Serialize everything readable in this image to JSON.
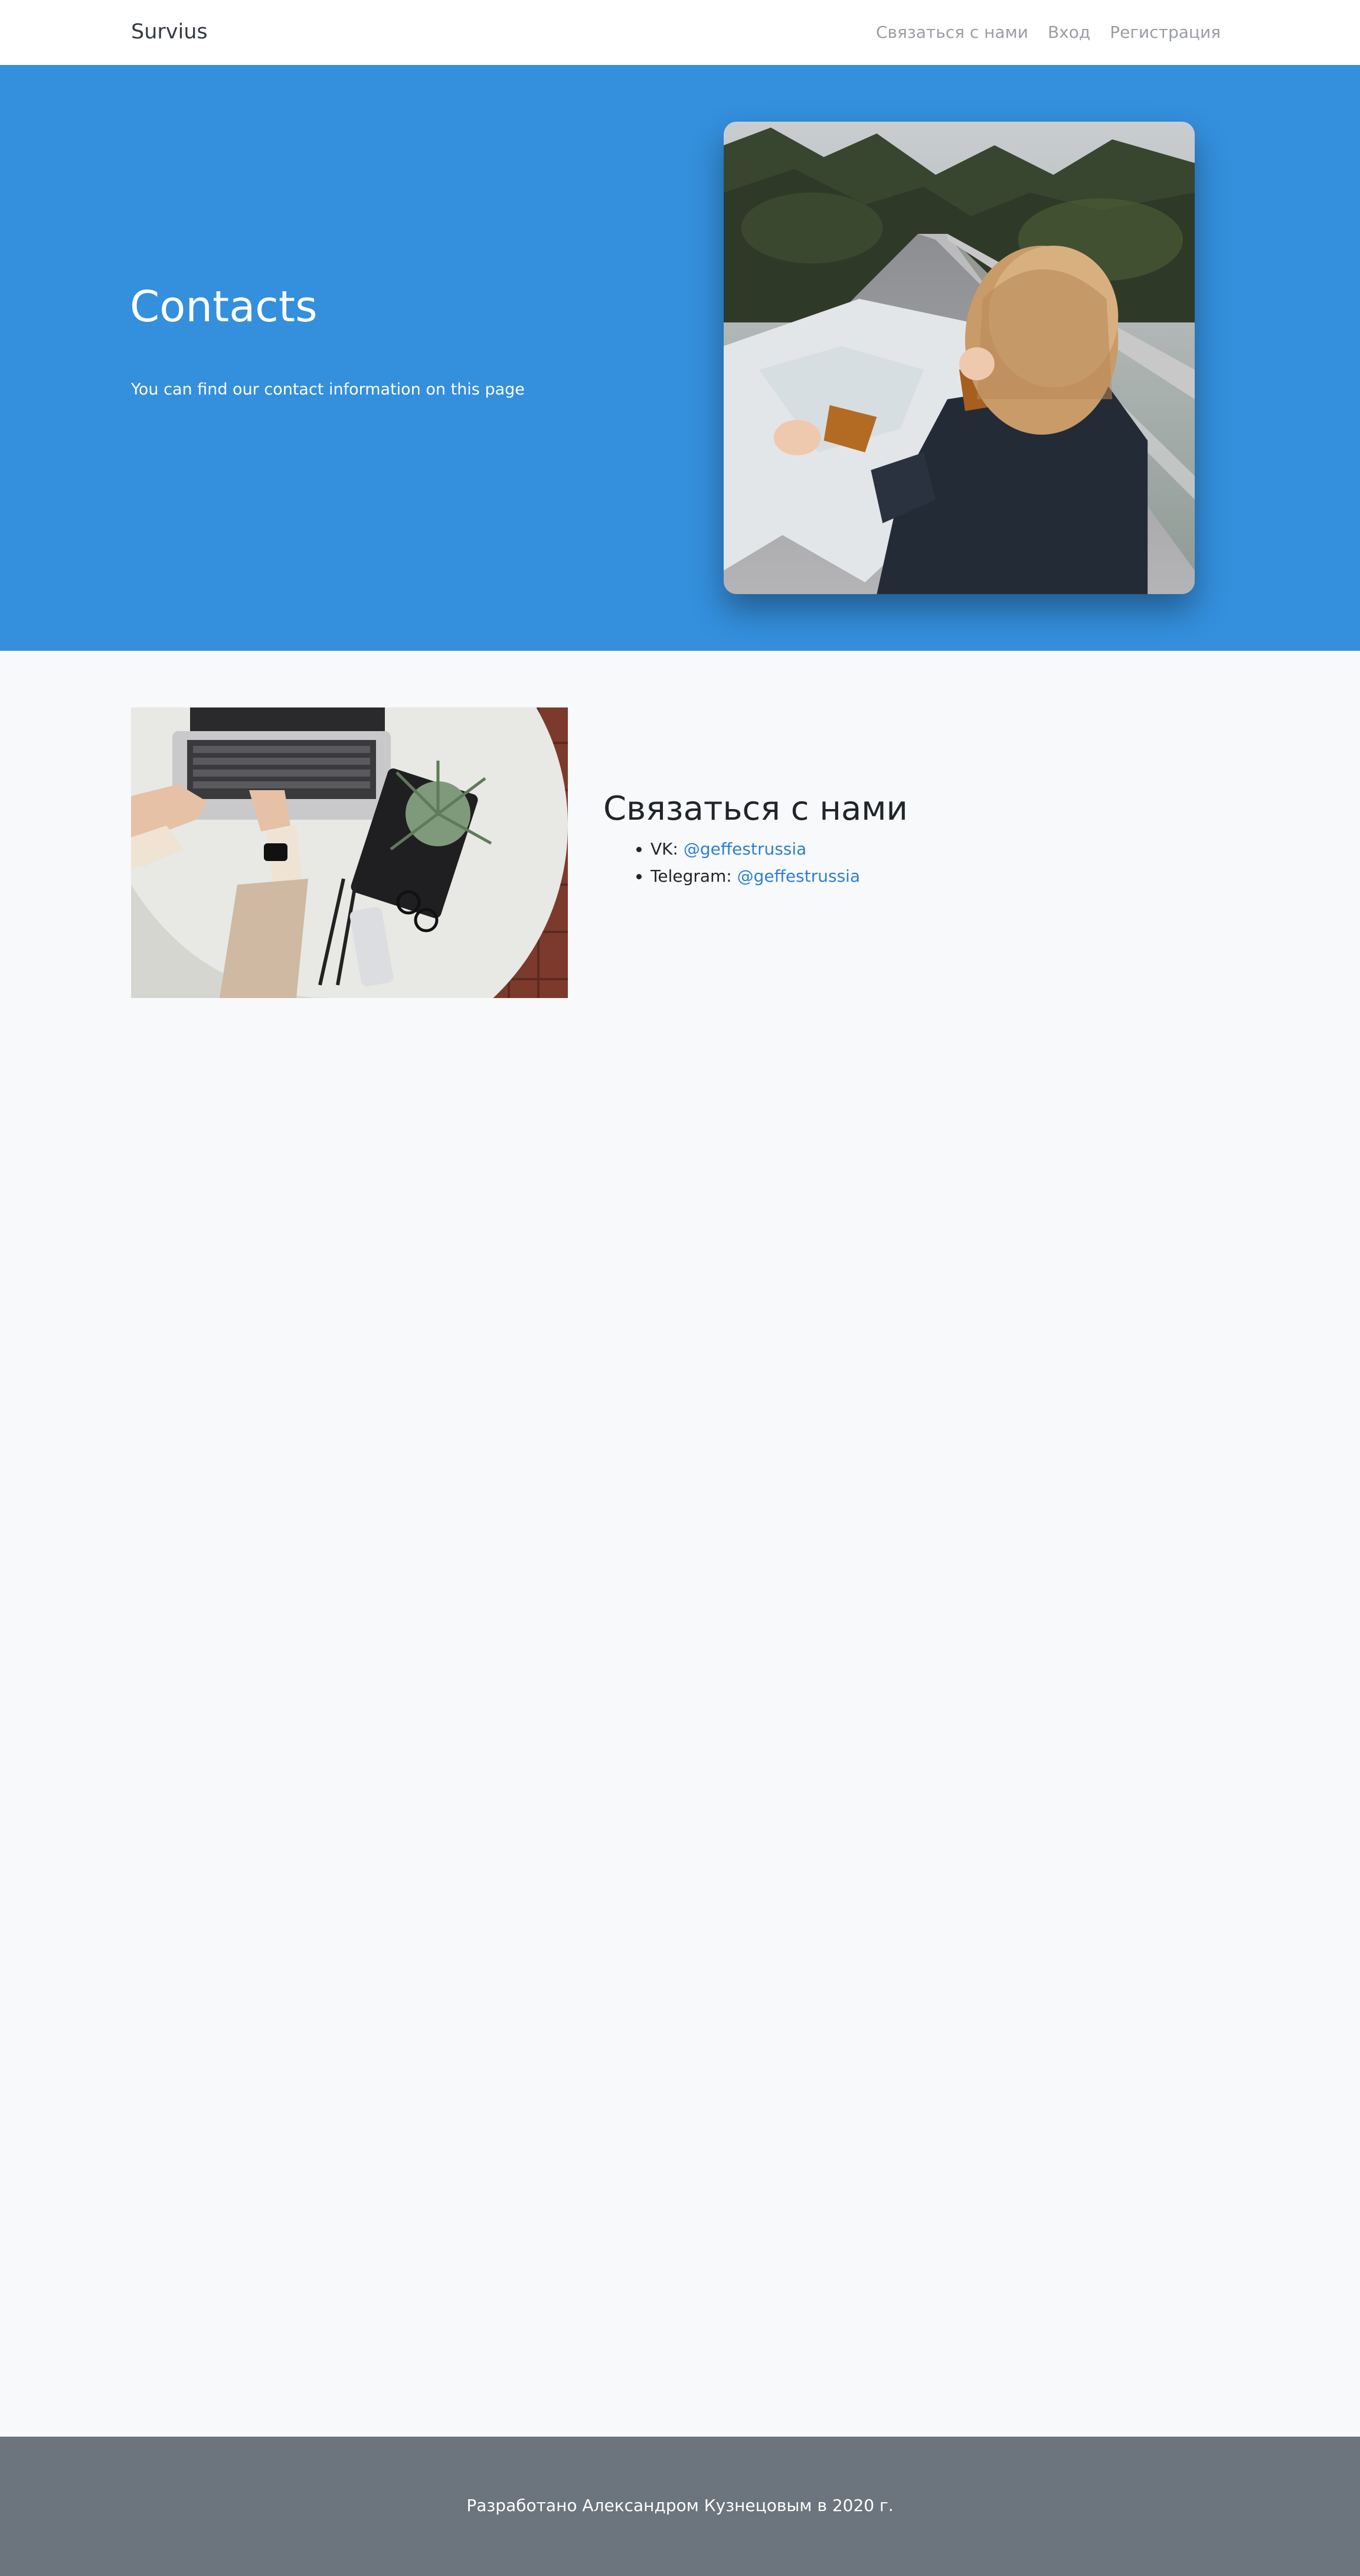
{
  "navbar": {
    "brand": "Survius",
    "links": [
      {
        "label": "Связаться с нами"
      },
      {
        "label": "Вход"
      },
      {
        "label": "Регистрация"
      }
    ]
  },
  "hero": {
    "title": "Contacts",
    "subtitle": "You can find our contact information on this page",
    "background_color": "#348fdd"
  },
  "contact": {
    "title": "Связаться с нами",
    "items": [
      {
        "label": "VK: ",
        "link_text": "@geffestrussia"
      },
      {
        "label": "Telegram: ",
        "link_text": "@geffestrussia"
      }
    ],
    "link_color": "#2d7fd3"
  },
  "footer": {
    "text": "Разработано Александром Кузнецовым в 2020 г.",
    "background_color": "#6c757d"
  }
}
